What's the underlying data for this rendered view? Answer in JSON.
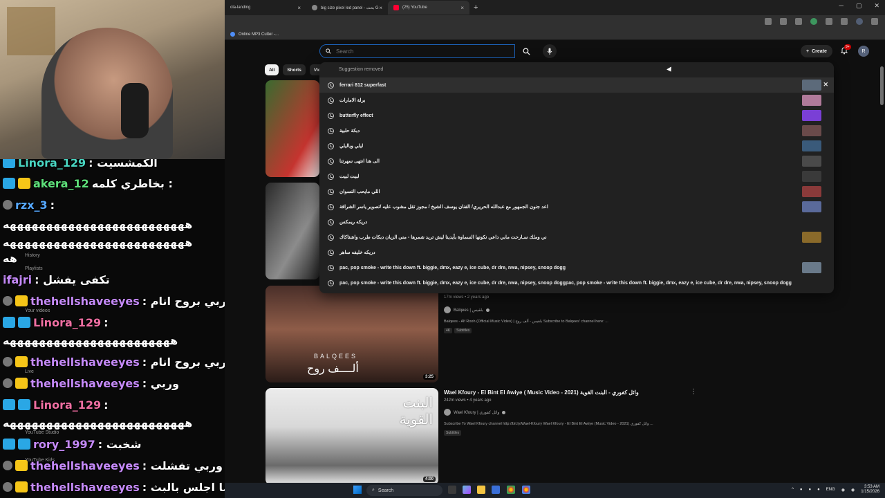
{
  "chat": {
    "lines": [
      {
        "user": "Linora_129",
        "msg": ": الكمشسيت"
      },
      {
        "user": "akera_12",
        "msg": "بخاطري كلمه :"
      },
      {
        "user": "rzx_3",
        "msg": ":"
      },
      {
        "user": "",
        "msg": "هههههههههههههههههههههههههه"
      },
      {
        "user": "",
        "msg": "هههههههههههههههههههههههههه"
      },
      {
        "user": "",
        "msg": "هه"
      },
      {
        "user": "ifajri",
        "msg": ": تكفى يفشل"
      },
      {
        "user": "thehellshaveeyes",
        "msg": ": يمه وربي بروح انام"
      },
      {
        "user": "Linora_129",
        "msg": ":"
      },
      {
        "user": "",
        "msg": "هههههههههههههههههههههههه"
      },
      {
        "user": "thehellshaveeyes",
        "msg": ": وربي بروح انام"
      },
      {
        "user": "thehellshaveeyes",
        "msg": ": وربي"
      },
      {
        "user": "Linora_129",
        "msg": ":"
      },
      {
        "user": "",
        "msg": "هههههههههههههههههههههههههه"
      },
      {
        "user": "rory_1997",
        "msg": ": شخبت"
      },
      {
        "user": "thehellshaveeyes",
        "msg": ": وربي تفشلت"
      },
      {
        "user": "thehellshaveeyes",
        "msg": ": وربي ما اجلس بالبث"
      }
    ],
    "ghost_labels": [
      "History",
      "Playlists",
      "Your videos",
      "Live",
      "YouTube Studio",
      "YouTube Kids"
    ]
  },
  "browser": {
    "tabs": [
      {
        "label": "ola-landing"
      },
      {
        "label": "big size pixel led panel - بحث G"
      },
      {
        "label": "(25) YouTube"
      }
    ],
    "bookmark": "Online MP3 Cutter -..."
  },
  "youtube": {
    "search_placeholder": "Search",
    "create_label": "Create",
    "bell_badge": "9+",
    "account_initial": "R",
    "chips": [
      "All",
      "Shorts",
      "Vid"
    ],
    "suggestion_removed": "Suggestion removed",
    "suggestions": [
      {
        "text": "ferrari 812 superfast",
        "thumb": "#5c6a7a"
      },
      {
        "text": "برلة الامارات",
        "thumb": "#b07a9a"
      },
      {
        "text": "butterfly effect",
        "thumb": "#7a3fd6"
      },
      {
        "text": "دبكة حلبية",
        "thumb": "#6a4a4a"
      },
      {
        "text": "ليلي وياليلي",
        "thumb": "#3a5a7a"
      },
      {
        "text": "الى هنا انتهى سهرتنا",
        "thumb": "#4a4a4a"
      },
      {
        "text": "لبيت لبيت",
        "thumb": "#3a3a3a"
      },
      {
        "text": "اللي مايحب النسوان",
        "thumb": "#8a3a3a"
      },
      {
        "text": "اعد جنون الجمهور مع عبدالله الحريري/ الفنان يوسف الشيخ / مجوز تقل مشوب عليه /تصوير ياسر الشراقة",
        "thumb": "#5a6a9a"
      },
      {
        "text": "دريكه ريمكس",
        "thumb": ""
      },
      {
        "text": "ني وملك سـارحت مابي داعي نكونها السماوة بأيدينا ليش تريد شمرها - مني الزيان دبكات طرب واشتاكاك",
        "thumb": "#8a6a2a"
      },
      {
        "text": "دريكه خليفه ساهر",
        "thumb": ""
      },
      {
        "text": "pac, pop smoke - write this down ft. biggie, dmx, eazy e, ice cube, dr dre, nwa, nipsey, snoop dogg",
        "thumb": "#6a7a8a"
      },
      {
        "text": "pac, pop smoke - write this down ft. biggie, dmx, eazy e, ice cube, dr dre, nwa, nipsey, snoop doggpac, pop smoke - write this down ft. biggie, dmx, eazy e, ice cube, dr dre, nwa, nipsey, snoop dogg",
        "thumb": ""
      }
    ],
    "videos": [
      {
        "title": "",
        "meta": "17m views • 2 years ago",
        "channel": "Balqees | بلقيس",
        "desc": "Balqees - Alf Rooh (Official Music Video) | بلقيس - ألف روح Subscribe to Balqees' channel here: ...",
        "tags": [
          "4K",
          "Subtitles"
        ],
        "duration": "3:25",
        "thumb_brand": "BALQEES",
        "thumb_text": "ألــــف روح"
      },
      {
        "title": "Wael Kfoury - El Bint El Awiye ( Music Video - 2021) وائل كفوري - البنت القوية",
        "meta": "242m views • 4 years ago",
        "channel": "Wael Kfoury | وائل كفوري",
        "desc": "Subscribe To Wael Kfoury channel http://bit.ly/Wael-Kfoury Wael Kfoury - El Bint El Awiye (Music Video - 2021) وائل كفوري ...",
        "tags": [
          "Subtitles"
        ],
        "duration": "4:00",
        "thumb_text_1": "البنت",
        "thumb_text_2": "القوية"
      }
    ]
  },
  "taskbar": {
    "search_label": "Search",
    "lang": "ENG",
    "time": "3:53 AM",
    "date": "1/15/2026"
  },
  "colors": {
    "background": "#0f0f0f",
    "accent_blue": "#1c62b9",
    "youtube_red": "#ff0033"
  }
}
